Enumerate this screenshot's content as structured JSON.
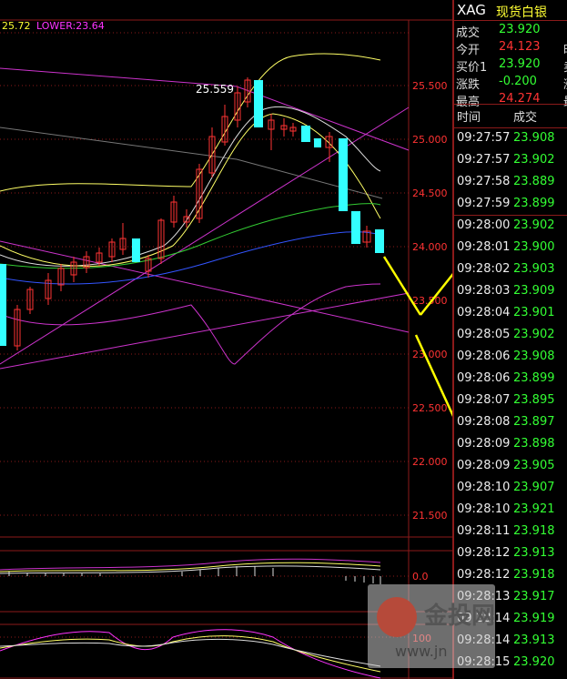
{
  "chart": {
    "indicator_upper": "25.72",
    "indicator_lower": "LOWER:23.64",
    "high_label": "25.559",
    "price_ticks": [
      "25.500",
      "25.000",
      "24.500",
      "24.000",
      "23.500",
      "23.000",
      "22.500",
      "22.000",
      "21.500"
    ],
    "osc_tick_1": "0.0",
    "osc_tick_2": "100"
  },
  "quote": {
    "symbol": "XAG",
    "name": "现货白银",
    "rows": [
      {
        "label": "成交",
        "value": "23.920",
        "color": "#33ff33",
        "cut": ""
      },
      {
        "label": "今开",
        "value": "24.123",
        "color": "#ff3333",
        "cut": "时"
      },
      {
        "label": "买价1",
        "value": "23.920",
        "color": "#33ff33",
        "cut": "卖"
      },
      {
        "label": "涨跌",
        "value": "-0.200",
        "color": "#33ff33",
        "cut": "涨"
      },
      {
        "label": "最高",
        "value": "24.274",
        "color": "#ff3333",
        "cut": "最"
      }
    ]
  },
  "ticks_header": {
    "time": "时间",
    "price": "成交"
  },
  "ticks": [
    {
      "time": "09:27:57",
      "price": "23.908"
    },
    {
      "time": "09:27:57",
      "price": "23.902"
    },
    {
      "time": "09:27:58",
      "price": "23.889"
    },
    {
      "time": "09:27:59",
      "price": "23.899"
    },
    {
      "time": "09:28:00",
      "price": "23.902"
    },
    {
      "time": "09:28:01",
      "price": "23.900"
    },
    {
      "time": "09:28:02",
      "price": "23.903"
    },
    {
      "time": "09:28:03",
      "price": "23.909"
    },
    {
      "time": "09:28:04",
      "price": "23.901"
    },
    {
      "time": "09:28:05",
      "price": "23.902"
    },
    {
      "time": "09:28:06",
      "price": "23.908"
    },
    {
      "time": "09:28:06",
      "price": "23.899"
    },
    {
      "time": "09:28:07",
      "price": "23.895"
    },
    {
      "time": "09:28:08",
      "price": "23.897"
    },
    {
      "time": "09:28:09",
      "price": "23.898"
    },
    {
      "time": "09:28:09",
      "price": "23.905"
    },
    {
      "time": "09:28:10",
      "price": "23.907"
    },
    {
      "time": "09:28:10",
      "price": "23.921"
    },
    {
      "time": "09:28:11",
      "price": "23.918"
    },
    {
      "time": "09:28:12",
      "price": "23.913"
    },
    {
      "time": "09:28:12",
      "price": "23.918"
    },
    {
      "time": "09:28:13",
      "price": "23.917"
    },
    {
      "time": "09:28:14",
      "price": "23.919"
    },
    {
      "time": "09:28:14",
      "price": "23.913"
    },
    {
      "time": "09:28:15",
      "price": "23.920"
    }
  ],
  "watermark": {
    "text": "金投网",
    "url": "www.jn"
  },
  "colors": {
    "up": "#ff3333",
    "down": "#33ffff",
    "tick_green": "#33ff33",
    "grid": "#8b1a1a",
    "arrow": "#ffff00"
  }
}
